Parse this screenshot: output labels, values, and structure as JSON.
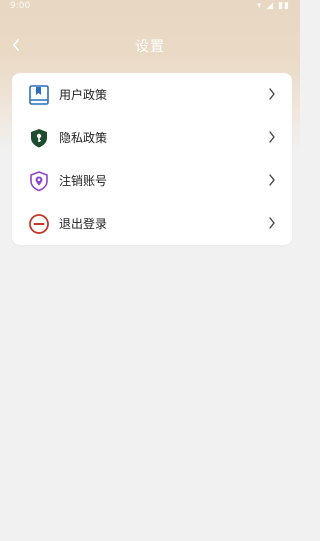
{
  "status_bar": {
    "time": "9:00",
    "indicators": "▾ ◢ ▮▮"
  },
  "header": {
    "title": "设置",
    "back_icon": "chevron-left-icon"
  },
  "settings": {
    "items": [
      {
        "label": "用户政策",
        "icon": "book-icon",
        "color": "#2b6fc2"
      },
      {
        "label": "隐私政策",
        "icon": "shield-lock-icon",
        "color": "#1d4d2e"
      },
      {
        "label": "注销账号",
        "icon": "shield-location-icon",
        "color": "#8e44c7"
      },
      {
        "label": "退出登录",
        "icon": "minus-circle-icon",
        "color": "#c0392b"
      }
    ]
  },
  "colors": {
    "header_gradient_top": "#e8d8c3",
    "background": "#f1f1f1",
    "card": "#ffffff"
  }
}
